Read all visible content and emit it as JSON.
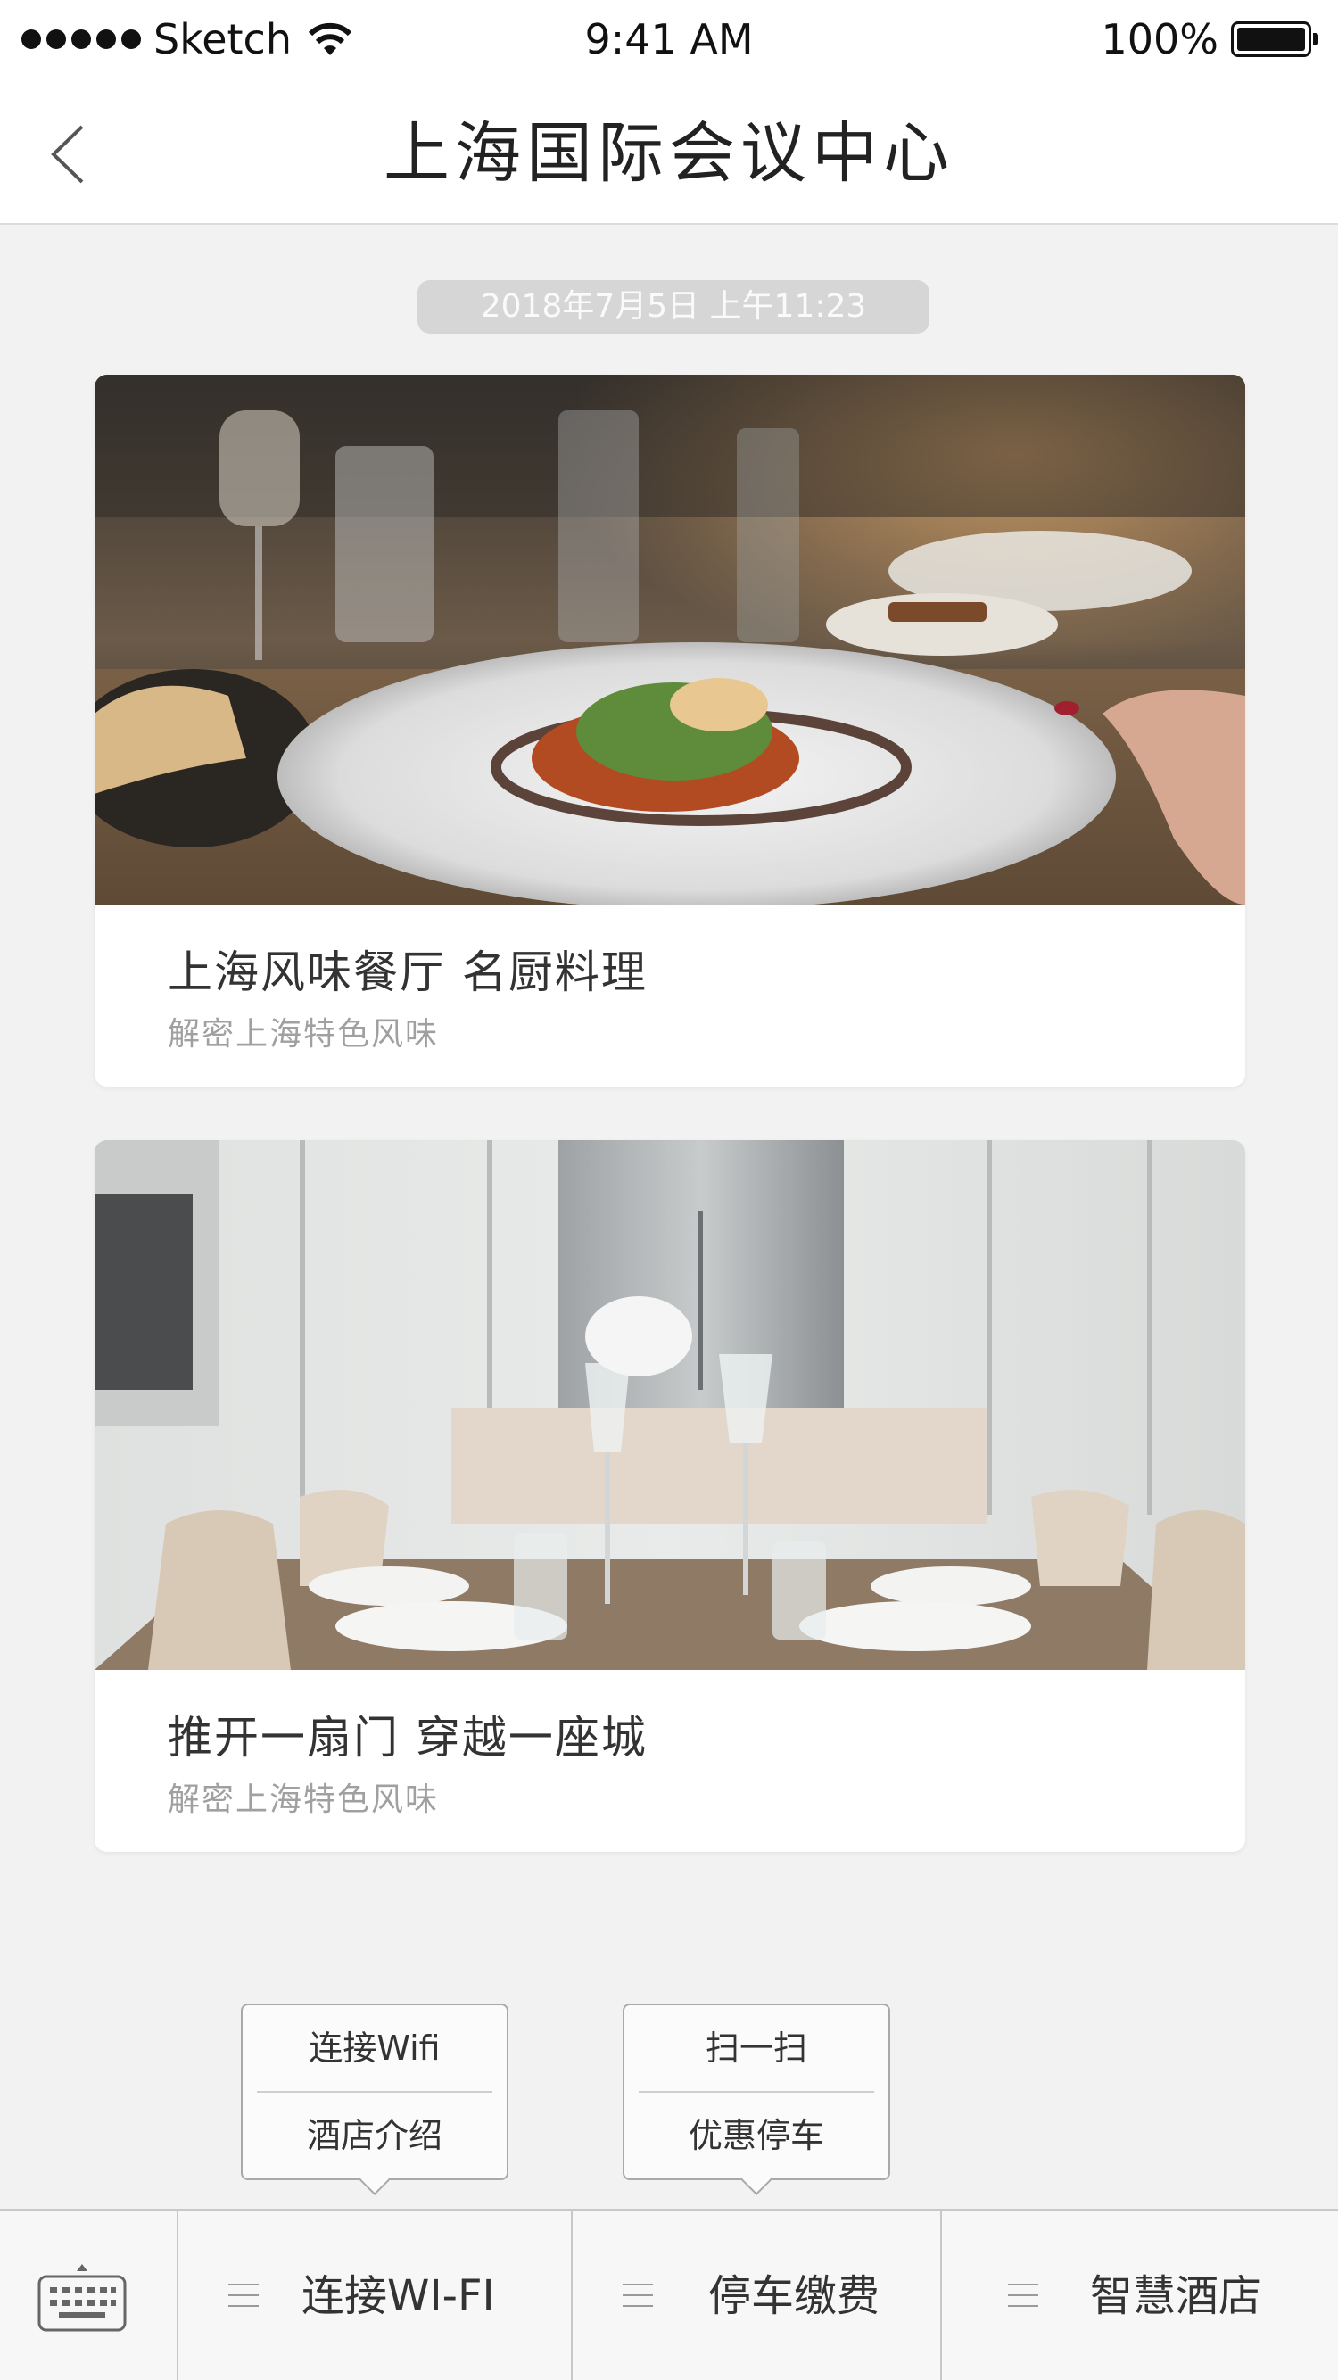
{
  "status_bar": {
    "carrier": "Sketch",
    "time": "9:41 AM",
    "battery": "100%"
  },
  "nav": {
    "title": "上海国际会议中心",
    "back_icon": "chevron-left-icon"
  },
  "timestamp": "2018年7月5日  上午11:23",
  "cards": [
    {
      "title": "上海风味餐厅 名厨料理",
      "subtitle": "解密上海特色风味",
      "image": "restaurant-dish-photo"
    },
    {
      "title": "推开一扇门 穿越一座城",
      "subtitle": "解密上海特色风味",
      "image": "dining-room-photo"
    }
  ],
  "popups": [
    {
      "items": [
        "连接Wifi",
        "酒店介绍"
      ]
    },
    {
      "items": [
        "扫一扫",
        "优惠停车"
      ]
    }
  ],
  "menu_bar": {
    "keyboard_icon": "keyboard-icon",
    "tabs": [
      {
        "label": "连接WI-FI"
      },
      {
        "label": "停车缴费"
      },
      {
        "label": "智慧酒店"
      }
    ]
  },
  "colors": {
    "background": "#f2f2f2",
    "card": "#ffffff",
    "timestamp_bg": "#d6d6d6",
    "border": "#c8c8c8"
  }
}
